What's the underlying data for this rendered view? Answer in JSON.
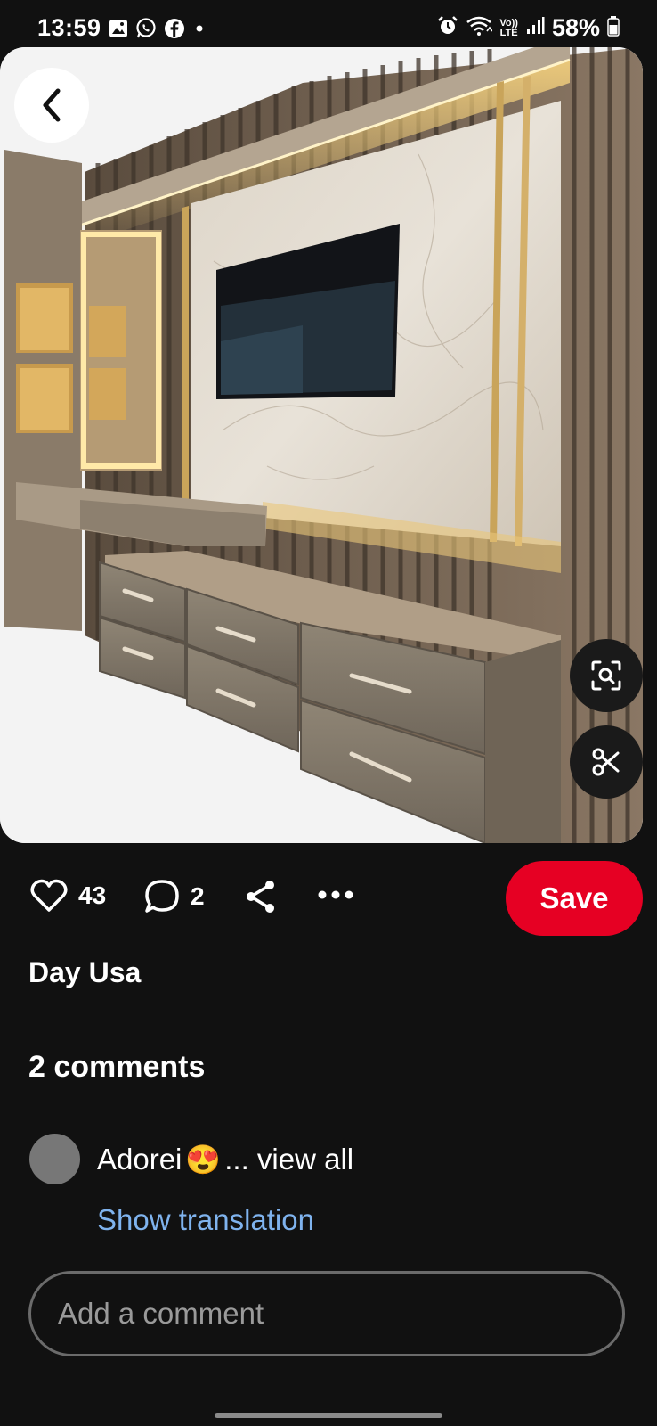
{
  "status_bar": {
    "time": "13:59",
    "left_icons": [
      "gallery-icon",
      "whatsapp-icon",
      "facebook-icon",
      "dot-icon"
    ],
    "right_icons": [
      "alarm-icon",
      "wifi-icon",
      "volte-icon",
      "signal-icon",
      "battery-icon"
    ],
    "volte_top": "Vo))",
    "volte_bottom": "LTE",
    "battery_text": "58%"
  },
  "image": {
    "description_icon": "tv-wall-panel-photo",
    "back_icon": "chevron-left-icon",
    "visual_search_icon": "visual-search-icon",
    "cutout_icon": "scissors-icon"
  },
  "actions": {
    "like_count": "43",
    "comment_count": "2",
    "save_label": "Save",
    "accent_color": "#e60023"
  },
  "pin": {
    "title": "Day Usa"
  },
  "comments": {
    "heading": "2 comments",
    "first_comment_text": "Adorei",
    "first_comment_emoji": "😍",
    "view_all": "... view all",
    "show_translation": "Show translation",
    "input_placeholder": "Add a comment",
    "link_color": "#7fb3ee"
  }
}
